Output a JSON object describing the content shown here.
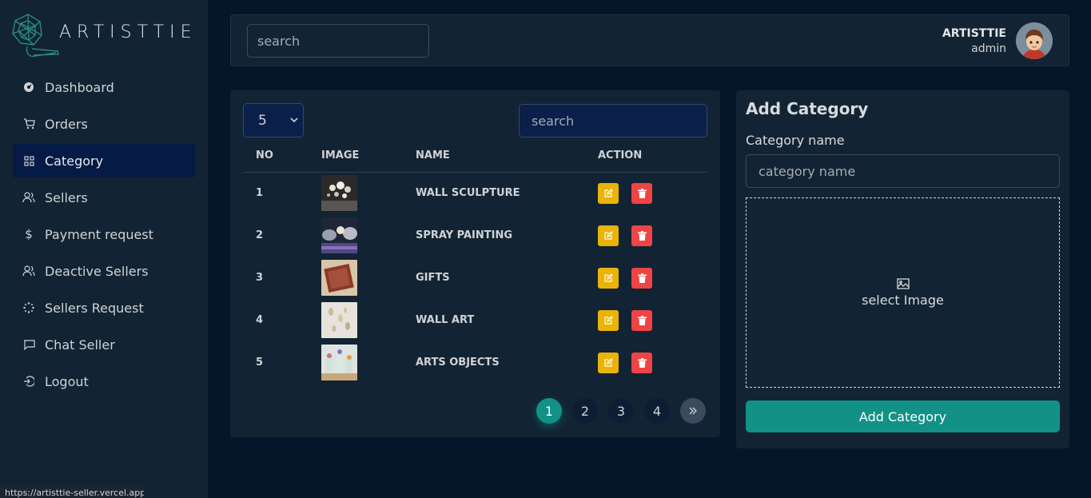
{
  "brand": {
    "name": "ARTISTTIE"
  },
  "sidebar": {
    "items": [
      {
        "label": "Dashboard",
        "icon": "dashboard-gauge-icon"
      },
      {
        "label": "Orders",
        "icon": "cart-icon"
      },
      {
        "label": "Category",
        "icon": "grid-icon",
        "active": true
      },
      {
        "label": "Sellers",
        "icon": "users-icon"
      },
      {
        "label": "Payment request",
        "icon": "dollar-icon"
      },
      {
        "label": "Deactive Sellers",
        "icon": "users-icon"
      },
      {
        "label": "Sellers Request",
        "icon": "loader-icon"
      },
      {
        "label": "Chat Seller",
        "icon": "chat-icon"
      },
      {
        "label": "Logout",
        "icon": "logout-icon"
      }
    ]
  },
  "header": {
    "search_placeholder": "search",
    "user_name": "ARTISTTIE",
    "user_role": "admin"
  },
  "table": {
    "per_page": "5",
    "search_placeholder": "search",
    "columns": [
      "NO",
      "IMAGE",
      "NAME",
      "ACTION"
    ],
    "rows": [
      {
        "no": "1",
        "name": "WALL SCULPTURE"
      },
      {
        "no": "2",
        "name": "SPRAY PAINTING"
      },
      {
        "no": "3",
        "name": "GIFTS"
      },
      {
        "no": "4",
        "name": "WALL ART"
      },
      {
        "no": "5",
        "name": "ARTS OBJECTS"
      }
    ],
    "pages": [
      "1",
      "2",
      "3",
      "4"
    ],
    "current_page": "1",
    "next_label": "»"
  },
  "add_category": {
    "title": "Add Category",
    "name_label": "Category name",
    "name_placeholder": "category name",
    "image_text": "select Image",
    "submit_label": "Add Category"
  },
  "status_bar": {
    "url": "https://artisttie-seller.vercel.app"
  },
  "colors": {
    "accent": "#129186",
    "edit": "#eab308",
    "delete": "#ef4444",
    "active_nav": "#051a45"
  }
}
